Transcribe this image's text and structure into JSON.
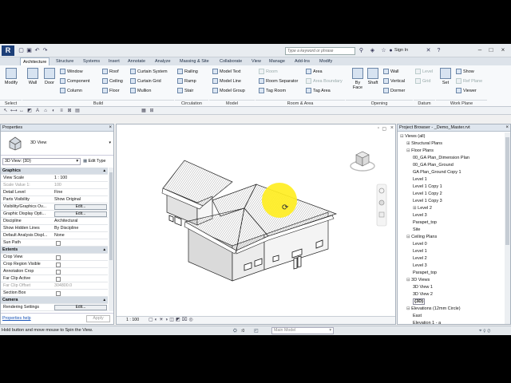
{
  "ribbon_tabs": [
    "Architecture",
    "Structure",
    "Systems",
    "Insert",
    "Annotate",
    "Analyze",
    "Massing & Site",
    "Collaborate",
    "View",
    "Manage",
    "Add-Ins",
    "Modify"
  ],
  "search_placeholder": "Type a keyword or phrase",
  "sign_in": "Sign In",
  "ribbon": {
    "modify": "Modify",
    "wall": "Wall",
    "door": "Door",
    "window": "Window",
    "component": "Component",
    "column": "Column",
    "roof": "Roof",
    "ceiling": "Ceiling",
    "floor": "Floor",
    "curtain_system": "Curtain System",
    "curtain_grid": "Curtain Grid",
    "mullion": "Mullion",
    "railing": "Railing",
    "ramp": "Ramp",
    "stair": "Stair",
    "model_text": "Model Text",
    "model_line": "Model Line",
    "model_group": "Model Group",
    "room": "Room",
    "room_separator": "Room Separator",
    "tag_room": "Tag Room",
    "area": "Area",
    "area_boundary": "Area Boundary",
    "tag_area": "Tag Area",
    "by_face": "By Face",
    "shaft": "Shaft",
    "wall_open": "Wall",
    "vertical": "Vertical",
    "dormer": "Dormer",
    "level": "Level",
    "grid": "Grid",
    "set": "Set",
    "show": "Show",
    "ref_plane": "Ref Plane",
    "viewer": "Viewer",
    "groups": {
      "select": "Select",
      "build": "Build",
      "circulation": "Circulation",
      "model": "Model",
      "room_area": "Room & Area",
      "opening": "Opening",
      "datum": "Datum",
      "work_plane": "Work Plane"
    }
  },
  "properties": {
    "title": "Properties",
    "type_name": "3D View",
    "selector": "3D View: {3D}",
    "edit_type": "Edit Type",
    "apply": "Apply",
    "help": "Properties help",
    "rows": [
      {
        "k": "Graphics",
        "cat": true
      },
      {
        "k": "View Scale",
        "v": "1 : 100"
      },
      {
        "k": "Scale Value    1:",
        "v": "100",
        "grey": true
      },
      {
        "k": "Detail Level",
        "v": "Fine"
      },
      {
        "k": "Parts Visibility",
        "v": "Show Original"
      },
      {
        "k": "Visibility/Graphics Ov...",
        "v": "Edit...",
        "btn": true
      },
      {
        "k": "Graphic Display Opti...",
        "v": "Edit...",
        "btn": true
      },
      {
        "k": "Discipline",
        "v": "Architectural"
      },
      {
        "k": "Show Hidden Lines",
        "v": "By Discipline"
      },
      {
        "k": "Default Analysis Displ...",
        "v": "None"
      },
      {
        "k": "Sun Path",
        "cb": true
      },
      {
        "k": "Extents",
        "cat": true
      },
      {
        "k": "Crop View",
        "cb": true
      },
      {
        "k": "Crop Region Visible",
        "cb": true
      },
      {
        "k": "Annotation Crop",
        "cb": true
      },
      {
        "k": "Far Clip Active",
        "cb": true
      },
      {
        "k": "Far Clip Offset",
        "v": "304800.0",
        "grey": true
      },
      {
        "k": "Section Box",
        "cb": true
      },
      {
        "k": "Camera",
        "cat": true
      },
      {
        "k": "Rendering Settings",
        "v": "Edit...",
        "btn": true
      }
    ]
  },
  "view": {
    "scale": "1 : 100"
  },
  "project_browser": {
    "title": "Project Browser - _Demo_Master.rvt",
    "items": [
      {
        "t": "Views (all)",
        "d": 0,
        "s": "-"
      },
      {
        "t": "Structural Plans",
        "d": 1,
        "s": "+"
      },
      {
        "t": "Floor Plans",
        "d": 1,
        "s": "-"
      },
      {
        "t": "00_GA Plan_Dimension Plan",
        "d": 2
      },
      {
        "t": "00_GA Plan_Ground",
        "d": 2
      },
      {
        "t": "GA Plan_Ground Copy 1",
        "d": 2
      },
      {
        "t": "Level 1",
        "d": 2
      },
      {
        "t": "Level 1 Copy 1",
        "d": 2
      },
      {
        "t": "Level 1 Copy 2",
        "d": 2
      },
      {
        "t": "Level 1 Copy 3",
        "d": 2
      },
      {
        "t": "Level 2",
        "d": 2,
        "s": "+"
      },
      {
        "t": "Level 3",
        "d": 2
      },
      {
        "t": "Parapet_top",
        "d": 2
      },
      {
        "t": "Site",
        "d": 2
      },
      {
        "t": "Ceiling Plans",
        "d": 1,
        "s": "-"
      },
      {
        "t": "Level 0",
        "d": 2
      },
      {
        "t": "Level 1",
        "d": 2
      },
      {
        "t": "Level 2",
        "d": 2
      },
      {
        "t": "Level 3",
        "d": 2
      },
      {
        "t": "Parapet_top",
        "d": 2
      },
      {
        "t": "3D Views",
        "d": 1,
        "s": "-"
      },
      {
        "t": "3D View 1",
        "d": 2
      },
      {
        "t": "3D View 2",
        "d": 2
      },
      {
        "t": "{3D}",
        "d": 2,
        "sel": true
      },
      {
        "t": "Elevations (12mm Circle)",
        "d": 1,
        "s": "-"
      },
      {
        "t": "East",
        "d": 2
      },
      {
        "t": "Elevation 1 - a",
        "d": 2
      }
    ]
  },
  "status": {
    "hint": "Hold button and move mouse to Spin the View.",
    "workset": "Main Model",
    "filter_count": ":0"
  },
  "colors": {
    "cursor_highlight": "#ffee22",
    "accent": "#1d3f78"
  }
}
